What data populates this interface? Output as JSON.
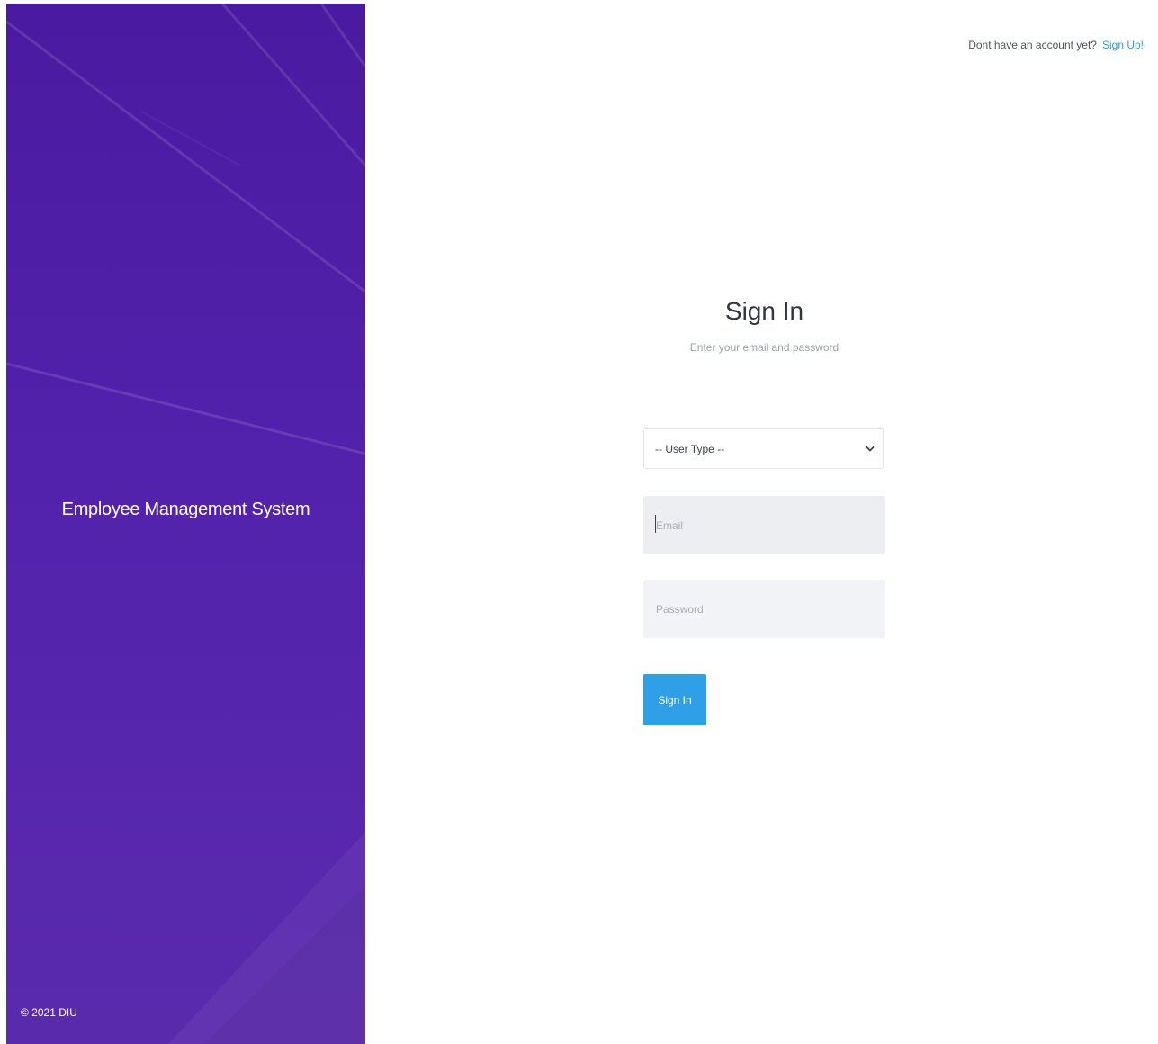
{
  "side_panel": {
    "brand_title": "Employee Management System",
    "copyright": "© 2021 DIU"
  },
  "header": {
    "prompt_text": "Dont have an account yet?",
    "signup_link": "Sign Up!"
  },
  "form": {
    "title": "Sign In",
    "subtitle": "Enter your email and password",
    "user_type_select": {
      "selected": "-- User Type --"
    },
    "email": {
      "placeholder": "Email",
      "value": ""
    },
    "password": {
      "placeholder": "Password",
      "value": ""
    },
    "submit_label": "Sign In"
  },
  "colors": {
    "panel_primary": "#4a1aa0",
    "accent": "#2f9fe8",
    "input_background": "#eef0f4"
  },
  "icons": {
    "select_chevron": "chevron-down-icon"
  }
}
